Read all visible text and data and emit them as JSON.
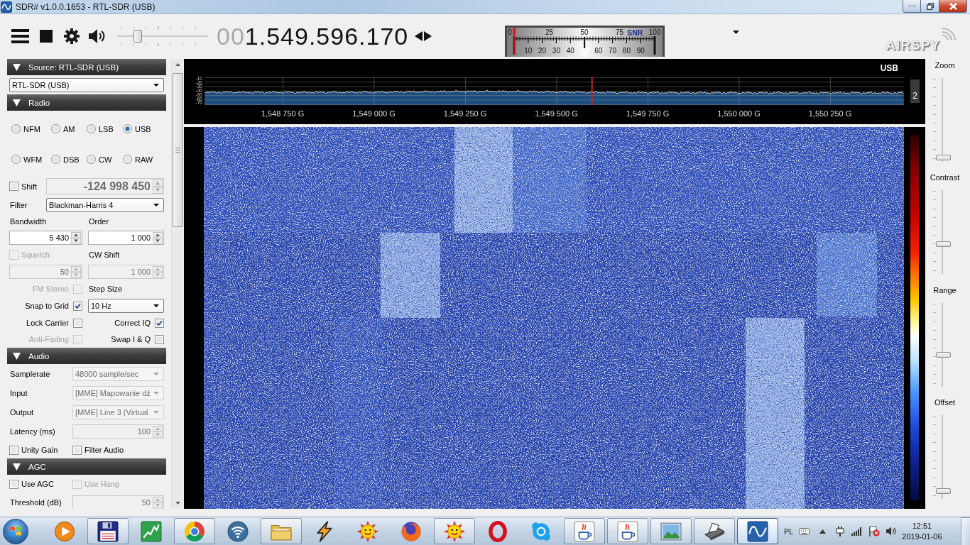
{
  "window": {
    "title": "SDR# v1.0.0.1653 - RTL-SDR (USB)"
  },
  "toolbar": {
    "volume": {
      "level": 0.2
    },
    "frequency_prefix": "00",
    "frequency": "1.549.596.170",
    "snr_meter": {
      "label": "SNR",
      "top_scale": [
        "0",
        "25",
        "50",
        "75",
        "100"
      ],
      "bottom_scale": [
        "10",
        "20",
        "30",
        "40",
        "60",
        "70",
        "80",
        "90"
      ],
      "level": 0
    },
    "logo": "AIRSPY"
  },
  "sidebar": {
    "sections": [
      {
        "title": "Source: RTL-SDR (USB)",
        "expanded": true,
        "rows": [
          {
            "kind": "full",
            "cells": [
              {
                "kind": "dropdown",
                "value": "RTL-SDR (USB)",
                "disabled": false
              }
            ]
          }
        ]
      },
      {
        "title": "Radio",
        "expanded": true,
        "rows": [
          {
            "kind": "radios",
            "options": [
              {
                "label": "NFM",
                "selected": false
              },
              {
                "label": "AM",
                "selected": false
              },
              {
                "label": "LSB",
                "selected": false
              },
              {
                "label": "USB",
                "selected": true
              },
              {
                "label": "WFM",
                "selected": false
              },
              {
                "label": "DSB",
                "selected": false
              },
              {
                "label": "CW",
                "selected": false
              },
              {
                "label": "RAW",
                "selected": false
              }
            ]
          },
          {
            "kind": "wide",
            "cells": [
              {
                "kind": "checkbox",
                "label": "Shift",
                "checked": false,
                "disabled": false
              },
              {
                "kind": "big_spin",
                "value": "-124 998 450",
                "disabled": true
              }
            ]
          },
          {
            "kind": "wide",
            "cells": [
              {
                "kind": "label",
                "text": "Filter",
                "disabled": false
              },
              {
                "kind": "dropdown",
                "value": "Blackman-Harris 4",
                "disabled": false
              }
            ]
          },
          {
            "kind": "pair",
            "cells": [
              {
                "kind": "label",
                "text": "Bandwidth",
                "disabled": false
              },
              {
                "kind": "label",
                "text": "Order",
                "disabled": false
              }
            ]
          },
          {
            "kind": "pair",
            "cells": [
              {
                "kind": "spin",
                "value": "5 430",
                "disabled": false
              },
              {
                "kind": "spin",
                "value": "1 000",
                "disabled": false
              }
            ]
          },
          {
            "kind": "pair",
            "cells": [
              {
                "kind": "checkbox",
                "label": "Squelch",
                "checked": false,
                "disabled": true
              },
              {
                "kind": "label",
                "text": "CW Shift",
                "disabled": false
              }
            ]
          },
          {
            "kind": "pair",
            "cells": [
              {
                "kind": "spin",
                "value": "50",
                "disabled": true
              },
              {
                "kind": "spin",
                "value": "1 000",
                "disabled": true
              }
            ]
          },
          {
            "kind": "pair",
            "cells": [
              {
                "kind": "check_right",
                "label": "FM Stereo",
                "checked": false,
                "disabled": true
              },
              {
                "kind": "label",
                "text": "Step Size",
                "disabled": false
              }
            ]
          },
          {
            "kind": "pair",
            "cells": [
              {
                "kind": "check_right",
                "label": "Snap to Grid",
                "checked": true,
                "disabled": false
              },
              {
                "kind": "dropdown",
                "value": "10 Hz",
                "disabled": false
              }
            ]
          },
          {
            "kind": "pair",
            "cells": [
              {
                "kind": "check_right",
                "label": "Lock Carrier",
                "checked": false,
                "disabled": false
              },
              {
                "kind": "check_right",
                "label": "Correct IQ",
                "checked": true,
                "disabled": false
              }
            ]
          },
          {
            "kind": "pair",
            "cells": [
              {
                "kind": "check_right",
                "label": "Anti-Fading",
                "checked": false,
                "disabled": true
              },
              {
                "kind": "check_right",
                "label": "Swap I & Q",
                "checked": false,
                "disabled": false
              }
            ]
          }
        ]
      },
      {
        "title": "Audio",
        "expanded": true,
        "rows": [
          {
            "kind": "form",
            "cells": [
              {
                "kind": "label",
                "text": "Samplerate",
                "disabled": false
              },
              {
                "kind": "dropdown",
                "value": "48000 sample/sec",
                "disabled": true
              }
            ]
          },
          {
            "kind": "form",
            "cells": [
              {
                "kind": "label",
                "text": "Input",
                "disabled": false
              },
              {
                "kind": "dropdown",
                "value": "[MME] Mapowanie dź",
                "disabled": true
              }
            ]
          },
          {
            "kind": "form",
            "cells": [
              {
                "kind": "label",
                "text": "Output",
                "disabled": false
              },
              {
                "kind": "dropdown",
                "value": "[MME] Line 3 (Virtual",
                "disabled": true
              }
            ]
          },
          {
            "kind": "form",
            "cells": [
              {
                "kind": "label",
                "text": "Latency (ms)",
                "disabled": false
              },
              {
                "kind": "spin",
                "value": "100",
                "disabled": true
              }
            ]
          },
          {
            "kind": "form",
            "cells": [
              {
                "kind": "checkbox",
                "label": "Unity Gain",
                "checked": false,
                "disabled": false
              },
              {
                "kind": "checkbox",
                "label": "Filter Audio",
                "checked": false,
                "disabled": false
              }
            ]
          }
        ]
      },
      {
        "title": "AGC",
        "expanded": true,
        "rows": [
          {
            "kind": "form",
            "cells": [
              {
                "kind": "checkbox",
                "label": "Use AGC",
                "checked": false,
                "disabled": false
              },
              {
                "kind": "checkbox",
                "label": "Use Hang",
                "checked": false,
                "disabled": true
              }
            ]
          },
          {
            "kind": "form",
            "cells": [
              {
                "kind": "label",
                "text": "Threshold (dB)",
                "disabled": false
              },
              {
                "kind": "spin",
                "value": "50",
                "disabled": true
              }
            ]
          }
        ]
      }
    ]
  },
  "spectrum": {
    "mode": "USB",
    "y_labels": [
      "-10",
      "-20",
      "-30",
      "-40",
      "-50",
      "-60",
      "-70"
    ],
    "frequency_labels": [
      "1,548 750 G",
      "1,549 000 G",
      "1,549 250 G",
      "1,549 500 G",
      "1,549 750 G",
      "1,550 000 G",
      "1,550 250 G"
    ],
    "side_badge": "2"
  },
  "display_controls": [
    {
      "label": "Zoom",
      "level": 0.05
    },
    {
      "label": "Contrast",
      "level": 0.36
    },
    {
      "label": "Range",
      "level": 0.38
    },
    {
      "label": "Offset",
      "level": 0.09
    }
  ],
  "taskbar": {
    "items": [
      {
        "kind": "player",
        "running": false,
        "selected": false
      },
      {
        "kind": "floppy",
        "running": true,
        "selected": false
      },
      {
        "kind": "chart",
        "running": false,
        "selected": false
      },
      {
        "kind": "ring",
        "running": true,
        "selected": false
      },
      {
        "kind": "wifi",
        "running": false,
        "selected": false
      },
      {
        "kind": "folder",
        "running": true,
        "selected": false
      },
      {
        "kind": "bolt",
        "running": false,
        "selected": false
      },
      {
        "kind": "sun",
        "running": false,
        "selected": false
      },
      {
        "kind": "globe",
        "running": false,
        "selected": false
      },
      {
        "kind": "sun",
        "running": true,
        "selected": false
      },
      {
        "kind": "oval",
        "running": false,
        "selected": false
      },
      {
        "kind": "bubble",
        "running": false,
        "selected": false
      },
      {
        "kind": "cup",
        "running": true,
        "selected": false
      },
      {
        "kind": "cup",
        "running": true,
        "selected": false
      },
      {
        "kind": "photo",
        "running": true,
        "selected": false
      },
      {
        "kind": "scanner",
        "running": true,
        "selected": false
      },
      {
        "kind": "wave",
        "running": true,
        "selected": true
      }
    ],
    "language": "PL",
    "time": "12:51",
    "date": "2019-01-06"
  }
}
